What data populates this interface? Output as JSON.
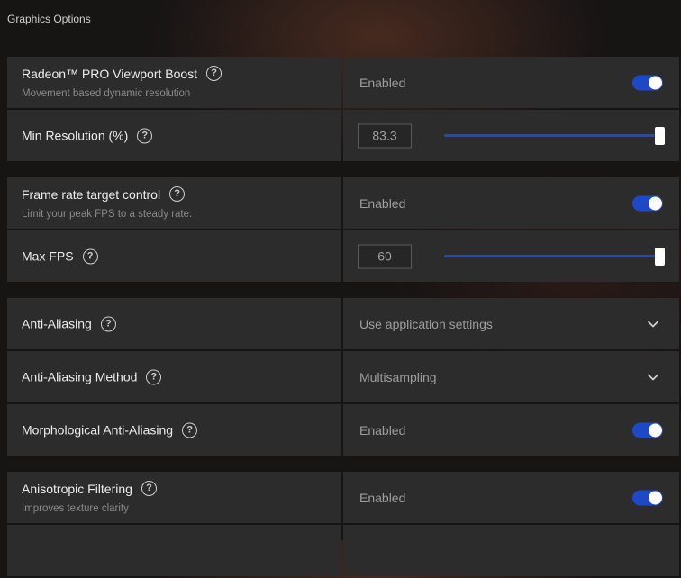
{
  "page": {
    "title": "Graphics Options"
  },
  "viewport_boost": {
    "label": "Radeon™ PRO Viewport Boost",
    "description": "Movement based dynamic resolution",
    "state": "Enabled",
    "enabled": true
  },
  "min_resolution": {
    "label": "Min Resolution (%)",
    "value": "83.3",
    "slider_fraction": 1.0
  },
  "frame_rate_target": {
    "label": "Frame rate target control",
    "description": "Limit your peak FPS to a steady rate.",
    "state": "Enabled",
    "enabled": true
  },
  "max_fps": {
    "label": "Max FPS",
    "value": "60",
    "slider_fraction": 1.0
  },
  "anti_aliasing": {
    "label": "Anti-Aliasing",
    "selected": "Use application settings"
  },
  "anti_aliasing_method": {
    "label": "Anti-Aliasing Method",
    "selected": "Multisampling"
  },
  "morphological_aa": {
    "label": "Morphological Anti-Aliasing",
    "state": "Enabled",
    "enabled": true
  },
  "anisotropic_filtering": {
    "label": "Anisotropic Filtering",
    "description": "Improves texture clarity",
    "state": "Enabled",
    "enabled": true
  },
  "icons": {
    "help": "help-circle-icon",
    "dropdown": "chevron-down-icon",
    "help_glyph": "?"
  },
  "colors": {
    "accent": "#1d49c9",
    "row_bg": "#2c2c2c",
    "page_bg": "#171414"
  }
}
